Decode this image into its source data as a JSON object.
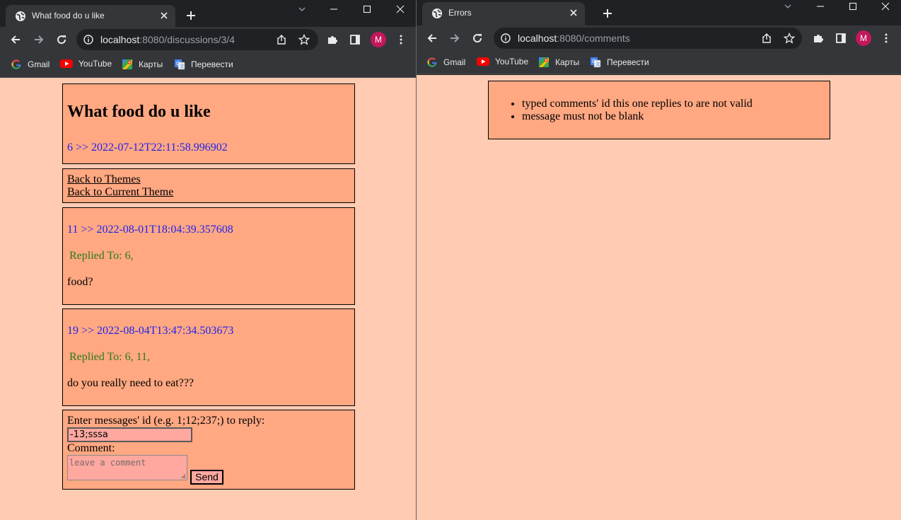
{
  "left_window": {
    "tab_title": "What food do u like",
    "url_host": "localhost",
    "url_path": ":8080/discussions/3/4",
    "avatar_letter": "M",
    "bookmarks": [
      {
        "label": "Gmail",
        "icon": "google-icon"
      },
      {
        "label": "YouTube",
        "icon": "youtube-icon"
      },
      {
        "label": "Карты",
        "icon": "maps-icon"
      },
      {
        "label": "Перевести",
        "icon": "translate-icon"
      }
    ],
    "page": {
      "theme_title": "What food do u like",
      "theme_meta": "6 >> 2022-07-12T22:11:58.996902",
      "nav_links": [
        "Back to Themes",
        "Back to Current Theme"
      ],
      "comments": [
        {
          "meta": "11 >> 2022-08-01T18:04:39.357608",
          "replied": "Replied To: 6,",
          "message": "food?"
        },
        {
          "meta": "19 >> 2022-08-04T13:47:34.503673",
          "replied": "Replied To: 6, 11,",
          "message": "do you really need to eat???"
        }
      ],
      "form": {
        "reply_label": "Enter messages' id (e.g. 1;12;237;) to reply:",
        "reply_value": "-13;sssa",
        "comment_label": "Comment:",
        "comment_placeholder": "leave a comment",
        "send_label": "Send"
      }
    }
  },
  "right_window": {
    "tab_title": "Errors",
    "url_host": "localhost",
    "url_path": ":8080/comments",
    "avatar_letter": "M",
    "bookmarks": [
      {
        "label": "Gmail",
        "icon": "google-icon"
      },
      {
        "label": "YouTube",
        "icon": "youtube-icon"
      },
      {
        "label": "Карты",
        "icon": "maps-icon"
      },
      {
        "label": "Перевести",
        "icon": "translate-icon"
      }
    ],
    "errors": [
      "typed comments' id this one replies to are not valid",
      "message must not be blank"
    ]
  },
  "colors": {
    "page_bg": "#ffcbb3",
    "box_bg": "#ffa882",
    "meta_text": "#2222ee",
    "replied_text": "#2d7a16",
    "chrome_dark": "#202124",
    "chrome_toolbar": "#35363a",
    "avatar": "#c2185b"
  }
}
